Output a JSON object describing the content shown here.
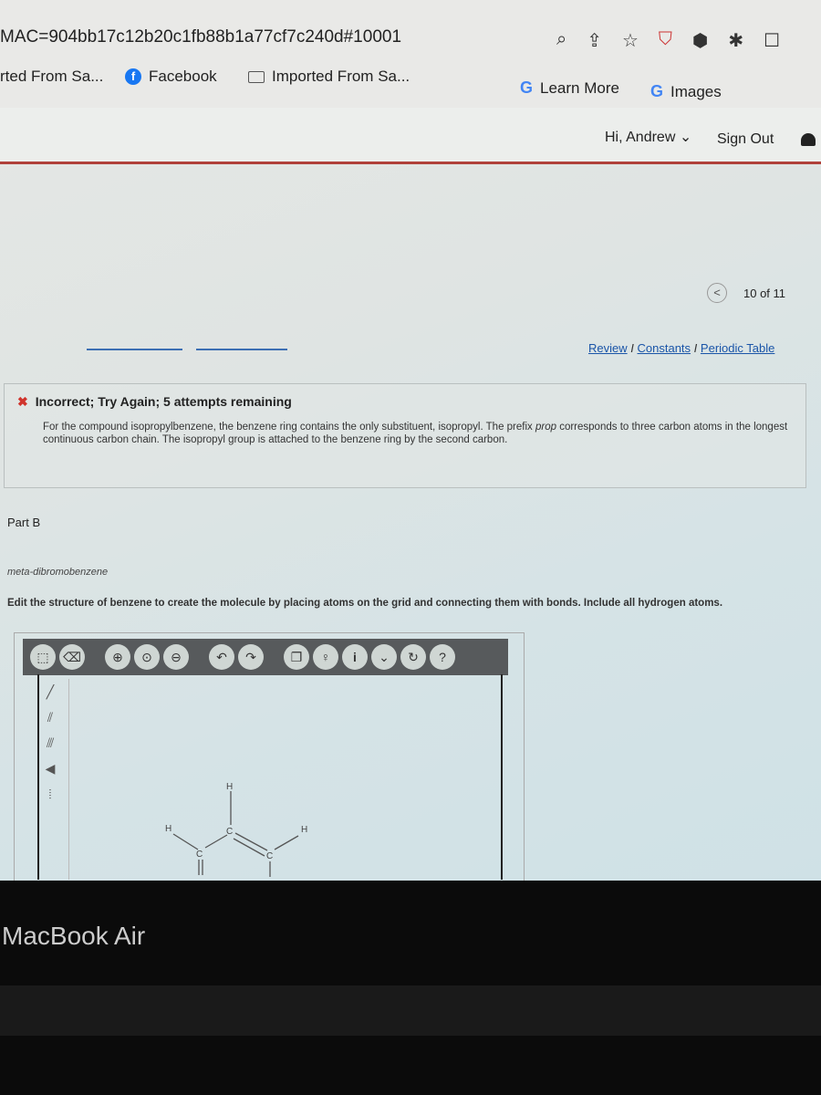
{
  "browser": {
    "url": "MAC=904bb17c12b20c1fb88b1a77cf7c240d#10001",
    "bookmarks": [
      {
        "label": "rted From Sa...",
        "icon": "none"
      },
      {
        "label": "Facebook",
        "icon": "facebook-icon"
      },
      {
        "label": "Imported From Sa...",
        "icon": "folder-icon"
      },
      {
        "label": "Learn More",
        "icon": "google-icon"
      },
      {
        "label": "Images",
        "icon": "google-icon"
      }
    ],
    "toolbar_icons": [
      "search-icon",
      "share-icon",
      "star-icon",
      "pdf-icon",
      "shield-icon",
      "puzzle-icon",
      "window-icon"
    ]
  },
  "header": {
    "greeting": "Hi, Andrew",
    "signout": "Sign Out"
  },
  "nav": {
    "prev": "<",
    "position": "10 of 11"
  },
  "links": {
    "review": "Review",
    "constants": "Constants",
    "periodic": "Periodic Table",
    "sep": "I"
  },
  "feedback": {
    "title": "Incorrect; Try Again; 5 attempts remaining",
    "body_a": "For the compound isopropylbenzene, the benzene ring contains the only substituent, isopropyl. The prefix ",
    "body_em": "prop",
    "body_b": " corresponds to three carbon atoms in the longest continuous carbon chain. The isopropyl group is attached to the benzene ring by the second carbon."
  },
  "part": {
    "label": "Part B",
    "compound": "meta-dibromobenzene",
    "instructions": "Edit the structure of benzene to create the molecule by placing atoms on the grid and connecting them with bonds. Include all hydrogen atoms."
  },
  "editor": {
    "tools": [
      "select-icon",
      "eraser-icon",
      "zoom-in-icon",
      "zoom-fit-icon",
      "zoom-out-icon",
      "undo-icon",
      "redo-icon",
      "copy-icon",
      "hint-icon",
      "info-icon",
      "more-icon",
      "reset-icon",
      "help-icon"
    ],
    "atoms": {
      "h": "H",
      "c": "C"
    }
  },
  "device": {
    "label": "MacBook Air"
  }
}
